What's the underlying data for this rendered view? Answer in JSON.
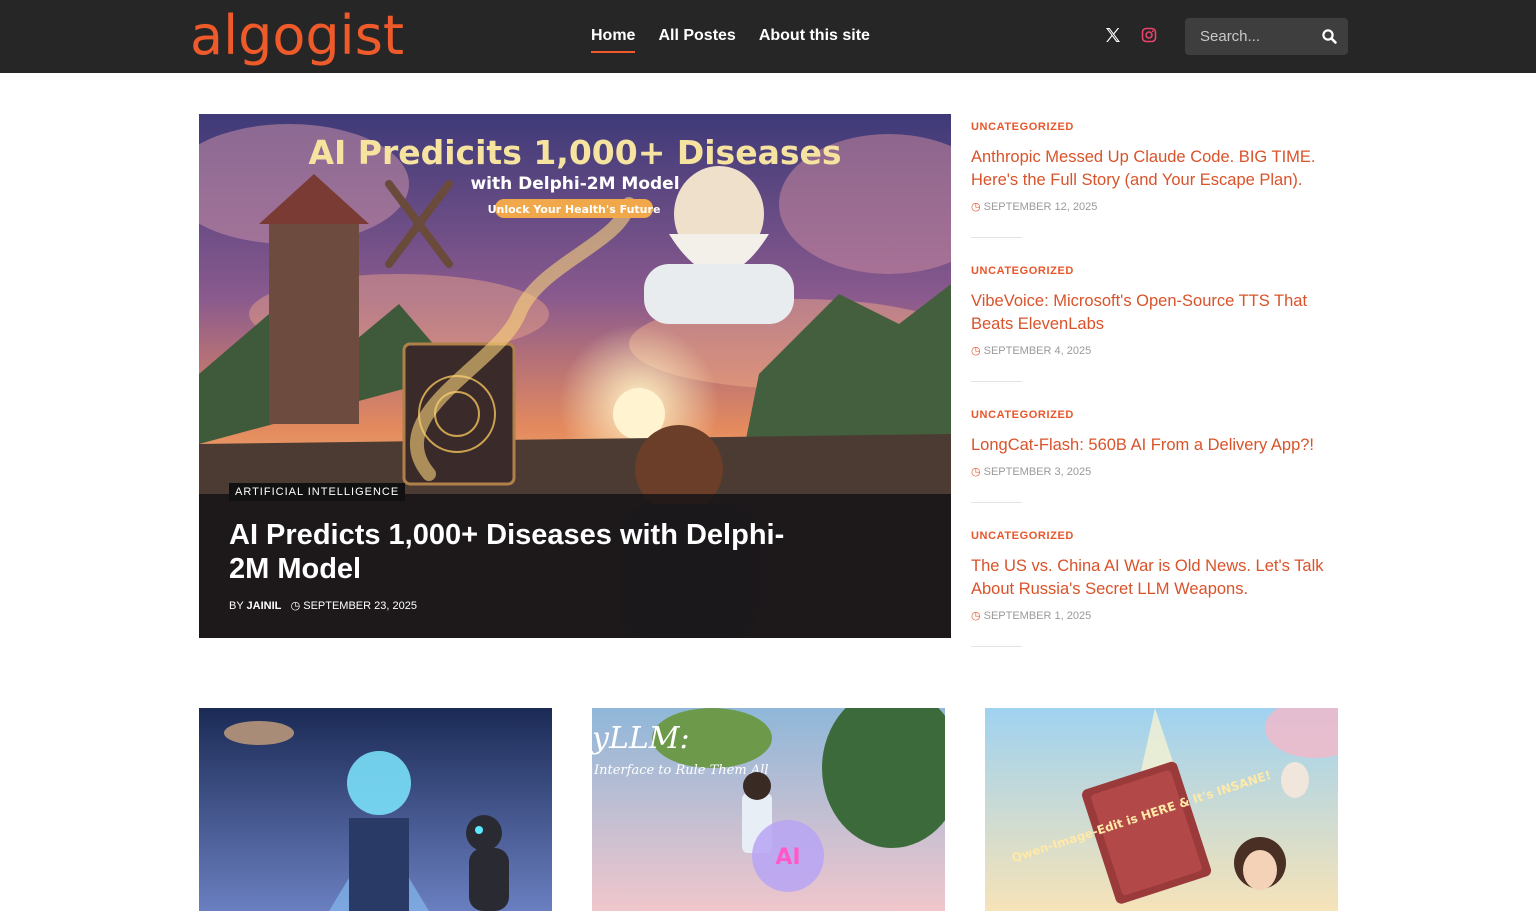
{
  "site": {
    "logo": "algogist",
    "nav": [
      "Home",
      "All Postes",
      "About this site"
    ],
    "search_placeholder": "Search..."
  },
  "hero": {
    "image_headline": "AI Predicits 1,000+ Diseases",
    "image_subheadline": "with Delphi-2M Model",
    "image_tagline": "Unlock Your Health's Future",
    "category": "ARTIFICIAL INTELLIGENCE",
    "title": "AI Predicts 1,000+ Diseases with Delphi-2M Model",
    "by_label": "BY",
    "author": "JAINIL",
    "date": "SEPTEMBER 23, 2025"
  },
  "side_posts": [
    {
      "category": "UNCATEGORIZED",
      "title": "Anthropic Messed Up Claude Code. BIG TIME. Here's the Full Story (and Your Escape Plan).",
      "date": "SEPTEMBER 12, 2025"
    },
    {
      "category": "UNCATEGORIZED",
      "title": "VibeVoice: Microsoft's Open-Source TTS That Beats ElevenLabs",
      "date": "SEPTEMBER 4, 2025"
    },
    {
      "category": "UNCATEGORIZED",
      "title": "LongCat-Flash: 560B AI From a Delivery App?!",
      "date": "SEPTEMBER 3, 2025"
    },
    {
      "category": "UNCATEGORIZED",
      "title": "The US vs. China AI War is Old News. Let's Talk About Russia's Secret LLM Weapons.",
      "date": "SEPTEMBER 1, 2025"
    }
  ],
  "cards": [
    {
      "image_text": ""
    },
    {
      "image_text": "yLLM:",
      "image_subtext": "Interface to Rule Them All",
      "orb_text": "AI"
    },
    {
      "image_text": "Qwen-Image-Edit is HERE & It's INSANE!"
    }
  ],
  "colors": {
    "accent": "#ef5a2a",
    "header_bg": "#262626",
    "link": "#d9532a"
  }
}
